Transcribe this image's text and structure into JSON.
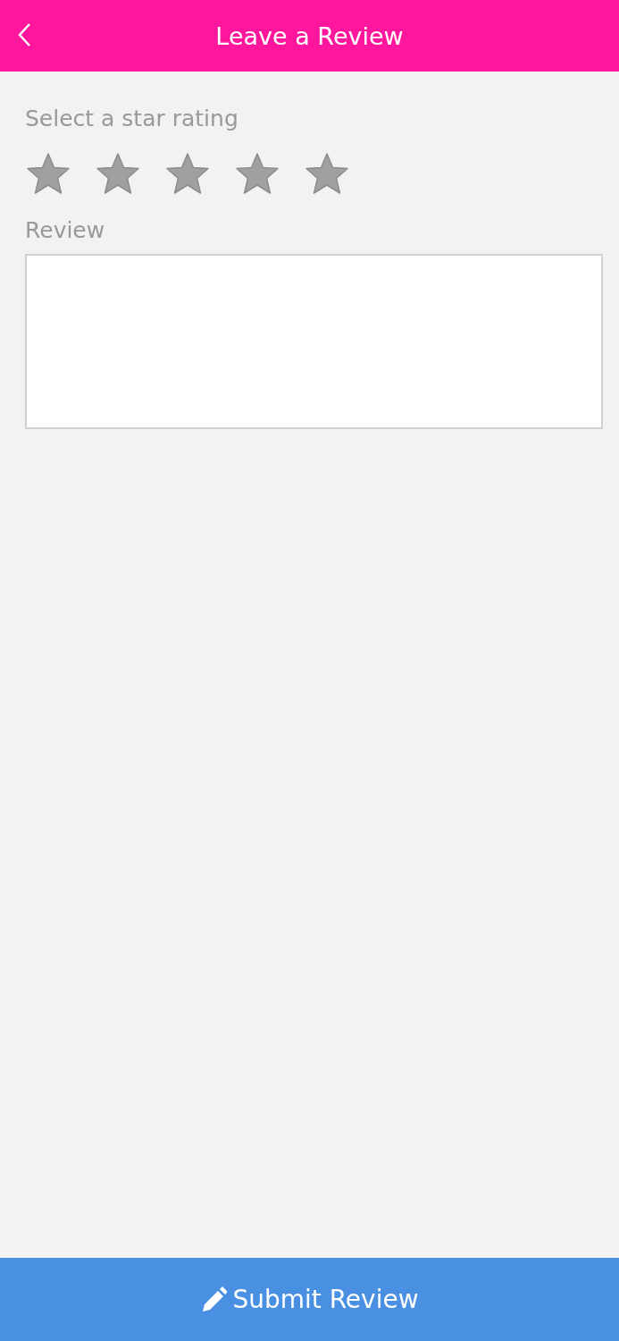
{
  "header": {
    "title": "Leave a Review"
  },
  "rating": {
    "label": "Select a star rating",
    "stars": 0
  },
  "review": {
    "label": "Review"
  },
  "submit_button": {
    "label": "Submit Review"
  }
}
